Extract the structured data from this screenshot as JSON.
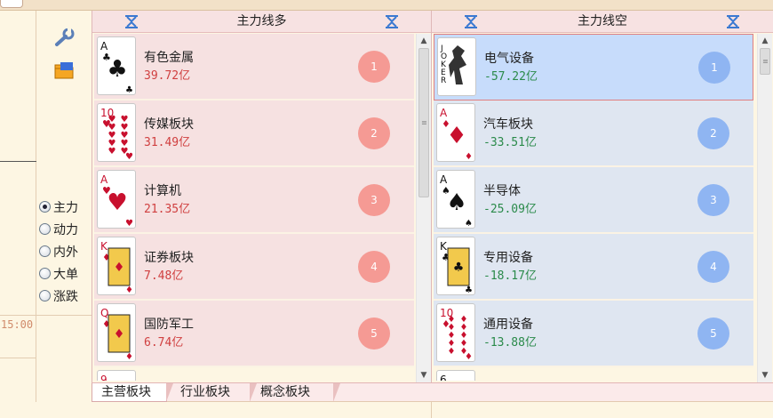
{
  "left": {
    "time": "15:00",
    "radios": [
      {
        "label": "主力",
        "checked": true
      },
      {
        "label": "动力",
        "checked": false
      },
      {
        "label": "内外",
        "checked": false
      },
      {
        "label": "大单",
        "checked": false
      },
      {
        "label": "涨跌",
        "checked": false
      }
    ]
  },
  "long_panel": {
    "title": "主力线多",
    "rows": [
      {
        "card": {
          "rank": "A",
          "suit": "♣",
          "color": "#111"
        },
        "name": "有色金属",
        "value": "39.72亿",
        "badge": "1"
      },
      {
        "card": {
          "rank": "10",
          "suit": "♥",
          "color": "#c8102e"
        },
        "name": "传媒板块",
        "value": "31.49亿",
        "badge": "2"
      },
      {
        "card": {
          "rank": "A",
          "suit": "♥",
          "color": "#c8102e"
        },
        "name": "计算机",
        "value": "21.35亿",
        "badge": "3"
      },
      {
        "card": {
          "rank": "K",
          "suit": "♦",
          "color": "#c8102e"
        },
        "name": "证券板块",
        "value": "7.48亿",
        "badge": "4"
      },
      {
        "card": {
          "rank": "Q",
          "suit": "♦",
          "color": "#c8102e"
        },
        "name": "国防军工",
        "value": "6.74亿",
        "badge": "5"
      }
    ],
    "partial_card": {
      "rank": "9",
      "color": "#c8102e"
    }
  },
  "short_panel": {
    "title": "主力线空",
    "rows": [
      {
        "card": {
          "rank": "JOKER",
          "suit": "",
          "color": "#111"
        },
        "name": "电气设备",
        "value": "-57.22亿",
        "badge": "1"
      },
      {
        "card": {
          "rank": "A",
          "suit": "♦",
          "color": "#c8102e"
        },
        "name": "汽车板块",
        "value": "-33.51亿",
        "badge": "2"
      },
      {
        "card": {
          "rank": "A",
          "suit": "♠",
          "color": "#111"
        },
        "name": "半导体",
        "value": "-25.09亿",
        "badge": "3"
      },
      {
        "card": {
          "rank": "K",
          "suit": "♣",
          "color": "#111"
        },
        "name": "专用设备",
        "value": "-18.17亿",
        "badge": "4"
      },
      {
        "card": {
          "rank": "10",
          "suit": "♦",
          "color": "#c8102e"
        },
        "name": "通用设备",
        "value": "-13.88亿",
        "badge": "5"
      }
    ],
    "partial_card": {
      "rank": "6",
      "color": "#111"
    }
  },
  "tabs": [
    "主营板块",
    "行业板块",
    "概念板块"
  ],
  "colors": {
    "long_badge": "#f59a94",
    "short_badge": "#8fb5f2",
    "long_value": "#d04040",
    "short_value": "#2a8a4a"
  }
}
